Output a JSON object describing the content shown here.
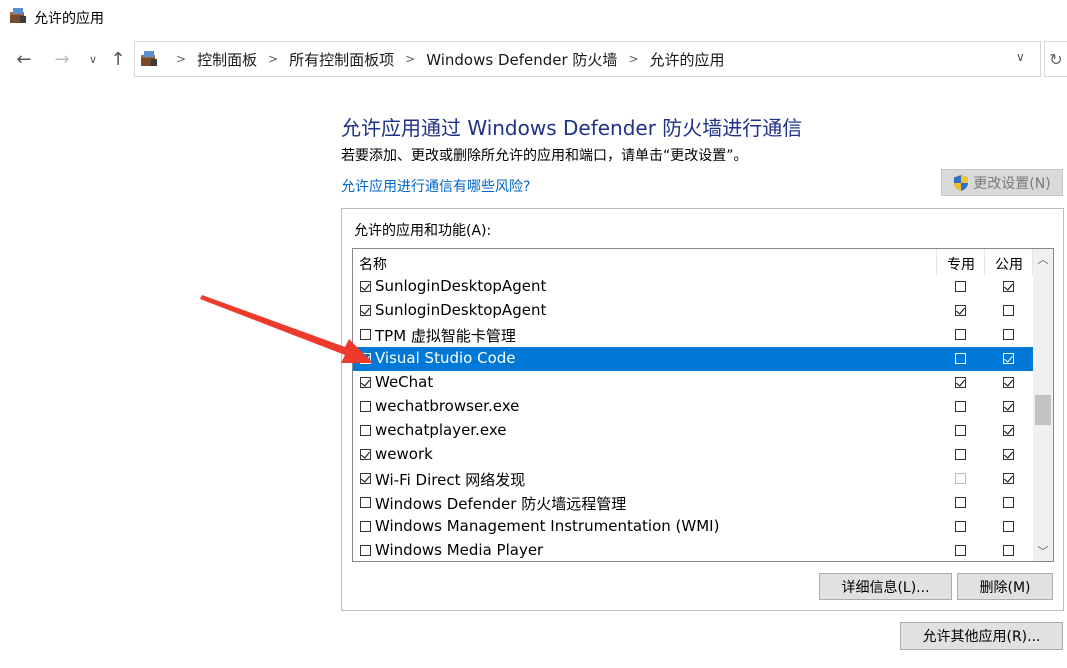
{
  "window": {
    "title": "允许的应用"
  },
  "address_bar": {
    "breadcrumbs": [
      "控制面板",
      "所有控制面板项",
      "Windows Defender 防火墙",
      "允许的应用"
    ]
  },
  "main": {
    "heading": "允许应用通过 Windows Defender 防火墙进行通信",
    "description": "若要添加、更改或删除所允许的应用和端口，请单击“更改设置”。",
    "risk_link": "允许应用进行通信有哪些风险?",
    "change_settings_label": "更改设置(N)",
    "group_label": "允许的应用和功能(A):",
    "columns": {
      "name": "名称",
      "private": "专用",
      "public": "公用"
    },
    "rows": [
      {
        "name": "SunloginDesktopAgent",
        "enabled": true,
        "private": false,
        "public": true
      },
      {
        "name": "SunloginDesktopAgent",
        "enabled": true,
        "private": true,
        "public": false
      },
      {
        "name": "TPM 虚拟智能卡管理",
        "enabled": false,
        "private": false,
        "public": false
      },
      {
        "name": "Visual Studio Code",
        "enabled": true,
        "private": false,
        "public": true,
        "selected": true
      },
      {
        "name": "WeChat",
        "enabled": true,
        "private": true,
        "public": true
      },
      {
        "name": "wechatbrowser.exe",
        "enabled": false,
        "private": false,
        "public": true
      },
      {
        "name": "wechatplayer.exe",
        "enabled": false,
        "private": false,
        "public": true
      },
      {
        "name": "wework",
        "enabled": true,
        "private": false,
        "public": true
      },
      {
        "name": "Wi-Fi Direct 网络发现",
        "enabled": true,
        "private": false,
        "public": true,
        "private_disabled": true
      },
      {
        "name": "Windows Defender 防火墙远程管理",
        "enabled": false,
        "private": false,
        "public": false
      },
      {
        "name": "Windows Management Instrumentation (WMI)",
        "enabled": false,
        "private": false,
        "public": false
      },
      {
        "name": "Windows Media Player",
        "enabled": false,
        "private": false,
        "public": false
      }
    ],
    "details_label": "详细信息(L)...",
    "remove_label": "删除(M)",
    "allow_other_label": "允许其他应用(R)..."
  },
  "colors": {
    "heading": "#1e3287",
    "link": "#0066cc",
    "selection": "#0078d7",
    "annotation_arrow": "#ee3a2c"
  }
}
